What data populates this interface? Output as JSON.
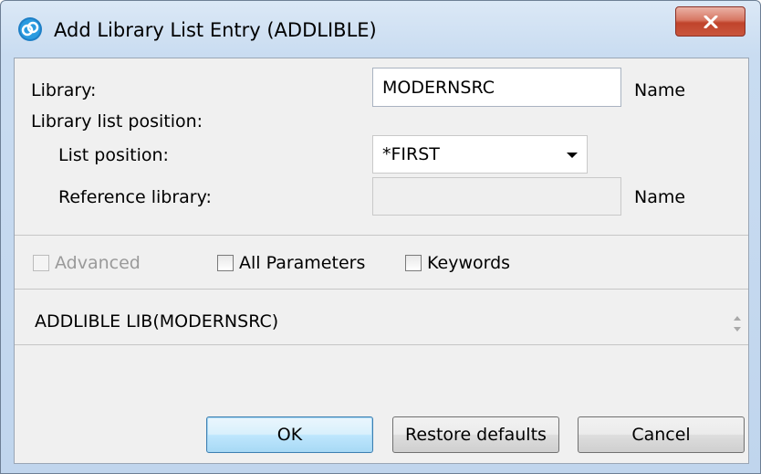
{
  "window": {
    "title": "Add Library List Entry (ADDLIBLE)",
    "close_glyph": "X",
    "accent_color": "#c0432b"
  },
  "form": {
    "library_label": "Library:",
    "library_value": "MODERNSRC",
    "library_suffix": "Name",
    "position_group_label": "Library list position:",
    "list_position_label": "List position:",
    "list_position_value": "*FIRST",
    "reference_library_label": "Reference library:",
    "reference_library_value": "",
    "reference_library_suffix": "Name"
  },
  "options": {
    "advanced_label": "Advanced",
    "all_parameters_label": "All Parameters",
    "keywords_label": "Keywords"
  },
  "command": {
    "text": "ADDLIBLE LIB(MODERNSRC)"
  },
  "buttons": {
    "ok": "OK",
    "restore_defaults": "Restore defaults",
    "cancel": "Cancel"
  },
  "icons": {
    "app": "app-logo-icon",
    "close": "close-icon",
    "dropdown": "chevron-down-icon",
    "scroll": "spinner-arrows-icon"
  }
}
